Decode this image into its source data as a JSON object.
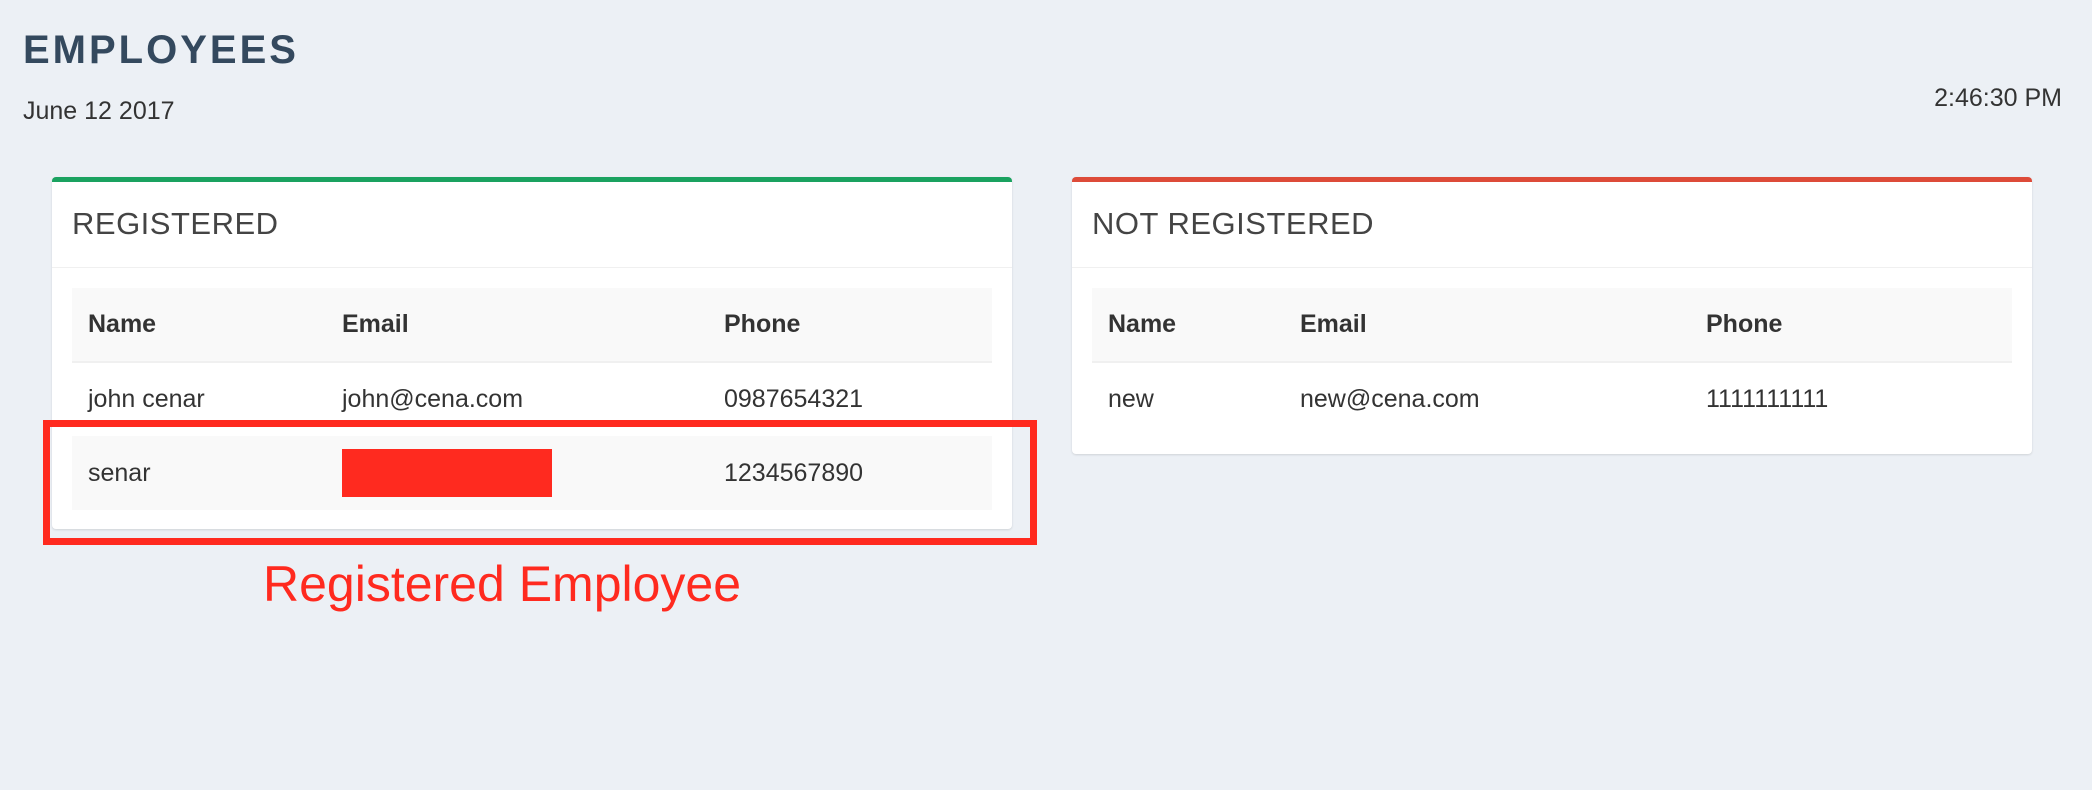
{
  "header": {
    "title": "EMPLOYEES",
    "date": "June 12 2017",
    "time": "2:46:30 PM"
  },
  "colors": {
    "background": "#ecf0f5",
    "registered_accent": "#1aa260",
    "not_registered_accent": "#dd4b39",
    "annotation": "#ff2a1f"
  },
  "registered": {
    "title": "REGISTERED",
    "columns": [
      "Name",
      "Email",
      "Phone"
    ],
    "rows": [
      {
        "name": "john cenar",
        "email": "john@cena.com",
        "phone": "0987654321"
      },
      {
        "name": "senar",
        "email": "",
        "phone": "1234567890"
      }
    ]
  },
  "not_registered": {
    "title": "NOT REGISTERED",
    "columns": [
      "Name",
      "Email",
      "Phone"
    ],
    "rows": [
      {
        "name": "new",
        "email": "new@cena.com",
        "phone": "1111111111"
      }
    ]
  },
  "annotation": {
    "label": "Registered Employee"
  }
}
